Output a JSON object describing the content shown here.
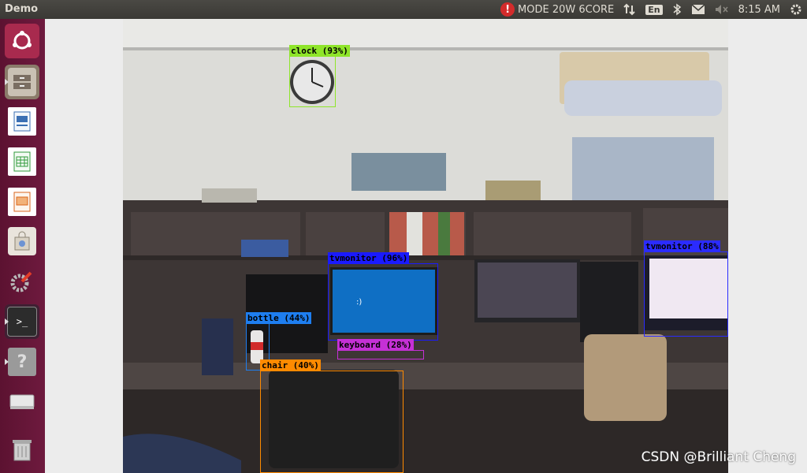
{
  "window": {
    "title": "Demo"
  },
  "top_panel": {
    "mode_text": "MODE 20W 6CORE",
    "language": "En",
    "clock": "8:15 AM",
    "icons": [
      "warning-icon",
      "network-updown-icon",
      "language-icon",
      "bluetooth-icon",
      "mail-icon",
      "volume-muted-icon",
      "settings-gear-icon"
    ]
  },
  "launcher": {
    "items": [
      {
        "name": "dash-home",
        "icon": "ubuntu-logo-icon"
      },
      {
        "name": "files",
        "icon": "file-cabinet-icon"
      },
      {
        "name": "writer",
        "icon": "document-icon"
      },
      {
        "name": "calc",
        "icon": "spreadsheet-icon"
      },
      {
        "name": "impress",
        "icon": "presentation-icon"
      },
      {
        "name": "software-center",
        "icon": "shopping-bag-icon"
      },
      {
        "name": "system-settings",
        "icon": "wrench-gear-icon"
      },
      {
        "name": "terminal",
        "icon": "terminal-icon"
      },
      {
        "name": "help",
        "icon": "question-icon"
      },
      {
        "name": "drive",
        "icon": "disk-drive-icon"
      },
      {
        "name": "trash",
        "icon": "trash-icon"
      }
    ]
  },
  "detections": [
    {
      "label": "clock (93%)",
      "color": "#8fe52a"
    },
    {
      "label": "tvmonitor (96%)",
      "color": "#1a1aff"
    },
    {
      "label": "tvmonitor (88%",
      "color": "#2b2bff"
    },
    {
      "label": "bottle (44%)",
      "color": "#1e7ef0"
    },
    {
      "label": "keyboard (28%)",
      "color": "#c530d6"
    },
    {
      "label": "chair (40%)",
      "color": "#ff8a00"
    }
  ],
  "watermark": "CSDN @Brilliant Cheng",
  "colors": {
    "launcher_bg": "#6e1a3e",
    "panel_bg": "#3a3935"
  }
}
